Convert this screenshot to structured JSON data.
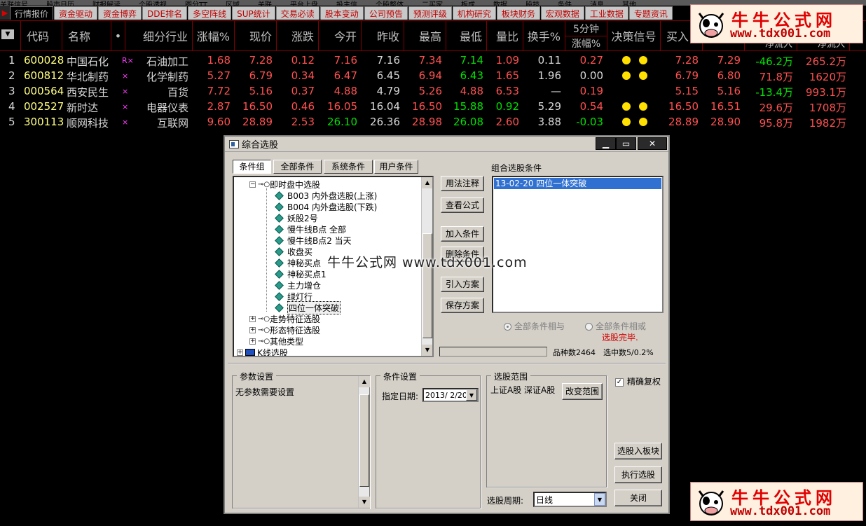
{
  "top_strip": [
    "关联信号",
    "股市日历",
    "财报解读",
    "个股透视",
    "图分TT",
    "区域",
    "关联",
    "平台上盘",
    "投主信",
    "个股整体",
    "二买家",
    "板成",
    "数据",
    "股技",
    "条件",
    "消息",
    "其他"
  ],
  "tabs": [
    {
      "label": "行情报价",
      "active": true
    },
    {
      "label": "资金驱动"
    },
    {
      "label": "资金博弈"
    },
    {
      "label": "DDE排名"
    },
    {
      "label": "多空阵线"
    },
    {
      "label": "SUP统计"
    },
    {
      "label": "交易必读"
    },
    {
      "label": "股本变动"
    },
    {
      "label": "公司预告"
    },
    {
      "label": "预测评级"
    },
    {
      "label": "机构研究"
    },
    {
      "label": "板块财务"
    },
    {
      "label": "宏观数据"
    },
    {
      "label": "工业数据"
    },
    {
      "label": "专题资讯"
    }
  ],
  "table": {
    "headers": {
      "code": "代码",
      "name": "名称",
      "mark": "•",
      "industry": "细分行业",
      "pct": "涨幅%",
      "price": "现价",
      "chg": "涨跌",
      "open": "今开",
      "prev": "昨收",
      "high": "最高",
      "low": "最低",
      "volratio": "量比",
      "turnover": "换手%",
      "min5_top": "5分钟",
      "min5_bottom": "涨幅%",
      "signal": "决策信号",
      "bid": "买入",
      "col_a": "",
      "col_b": "净流入",
      "col_c": "净流入"
    },
    "rows": [
      {
        "idx": "1",
        "code": "600028",
        "name": "中国石化",
        "mark": "R×",
        "industry": "石油加工",
        "pct": "1.68",
        "price": "7.28",
        "chg": "0.12",
        "open": "7.16",
        "prev": "7.16",
        "high": "7.34",
        "low": "7.14",
        "volratio": "1.09",
        "turnover": "0.11",
        "min5": "0.27",
        "dots": 2,
        "bid": "7.28",
        "ask": "7.29",
        "flow": "-46.2万",
        "flow2": "265.2万"
      },
      {
        "idx": "2",
        "code": "600812",
        "name": "华北制药",
        "mark": "×",
        "industry": "化学制药",
        "pct": "5.27",
        "price": "6.79",
        "chg": "0.34",
        "open": "6.47",
        "prev": "6.45",
        "high": "6.94",
        "low": "6.43",
        "volratio": "1.65",
        "turnover": "1.96",
        "min5": "0.00",
        "dots": 2,
        "bid": "6.79",
        "ask": "6.80",
        "flow": "71.8万",
        "flow2": "1620万"
      },
      {
        "idx": "3",
        "code": "000564",
        "name": "西安民生",
        "mark": "×",
        "industry": "百货",
        "pct": "7.72",
        "price": "5.16",
        "chg": "0.37",
        "open": "4.88",
        "prev": "4.79",
        "high": "5.26",
        "low": "4.88",
        "volratio": "6.53",
        "turnover": "—",
        "min5": "0.19",
        "dots": 0,
        "bid": "5.15",
        "ask": "5.16",
        "flow": "-13.4万",
        "flow2": "993.1万"
      },
      {
        "idx": "4",
        "code": "002527",
        "name": "新时达",
        "mark": "×",
        "industry": "电器仪表",
        "pct": "2.87",
        "price": "16.50",
        "chg": "0.46",
        "open": "16.05",
        "prev": "16.04",
        "high": "16.50",
        "low": "15.88",
        "volratio": "0.92",
        "turnover": "5.29",
        "min5": "0.54",
        "dots": 2,
        "bid": "16.50",
        "ask": "16.51",
        "flow": "29.6万",
        "flow2": "1708万"
      },
      {
        "idx": "5",
        "code": "300113",
        "name": "顺网科技",
        "mark": "×",
        "industry": "互联网",
        "pct": "9.60",
        "price": "28.89",
        "chg": "2.53",
        "open": "26.10",
        "prev": "26.36",
        "high": "28.98",
        "low": "26.08",
        "volratio": "2.60",
        "turnover": "3.88",
        "min5": "-0.03",
        "dots": 2,
        "bid": "28.89",
        "ask": "28.90",
        "flow": "95.8万",
        "flow2": "1982万"
      }
    ]
  },
  "dialog": {
    "title": "综合选股",
    "cond_tabs": [
      "条件组",
      "全部条件",
      "系统条件",
      "用户条件"
    ],
    "tree": {
      "root1": "即时盘中选股",
      "children": [
        "B003 内外盘选股(上涨)",
        "B004 内外盘选股(下跌)",
        "妖股2号",
        "慢牛线B点 全部",
        "慢牛线B点2 当天",
        "收盘买",
        "神秘买点",
        "神秘买点1",
        "主力增仓",
        "绿灯行",
        "四位一体突破"
      ],
      "group2": "走势特征选股",
      "group3": "形态特征选股",
      "group4": "其他类型",
      "group5": "K线选股"
    },
    "buttons": {
      "usage": "用法注释",
      "formula": "查看公式",
      "add": "加入条件",
      "delete": "删除条件",
      "import": "引入方案",
      "save": "保存方案",
      "to_block": "选股入板块",
      "execute": "执行选股",
      "close": "关闭",
      "change_range": "改变范围"
    },
    "combo_label": "组合选股条件",
    "combo_item": "13-02-20 四位一体突破",
    "radio_all_and": "全部条件相与",
    "radio_all_or": "全部条件相或",
    "status": "选股完毕.",
    "count_label": "品种数2464",
    "selected_label": "选中数5/0.2%",
    "param_title": "参数设置",
    "param_text": "无参数需要设置",
    "cond_title": "条件设置",
    "date_label": "指定日期:",
    "date_value": "2013/ 2/20",
    "range_title": "选股范围",
    "range_text": "上证A股 深证A股",
    "exact_label": "精确复权",
    "period_label": "选股周期:",
    "period_value": "日线"
  },
  "watermark": "牛牛公式网 www.tdx001.com",
  "brand": {
    "title": "牛牛公式网",
    "url": "www.tdx001.com"
  },
  "colors": {
    "up": "#ff5050",
    "down": "#00e000",
    "grid": "#800000",
    "dialog_bg": "#d4d0c8",
    "select": "#3070d0"
  }
}
